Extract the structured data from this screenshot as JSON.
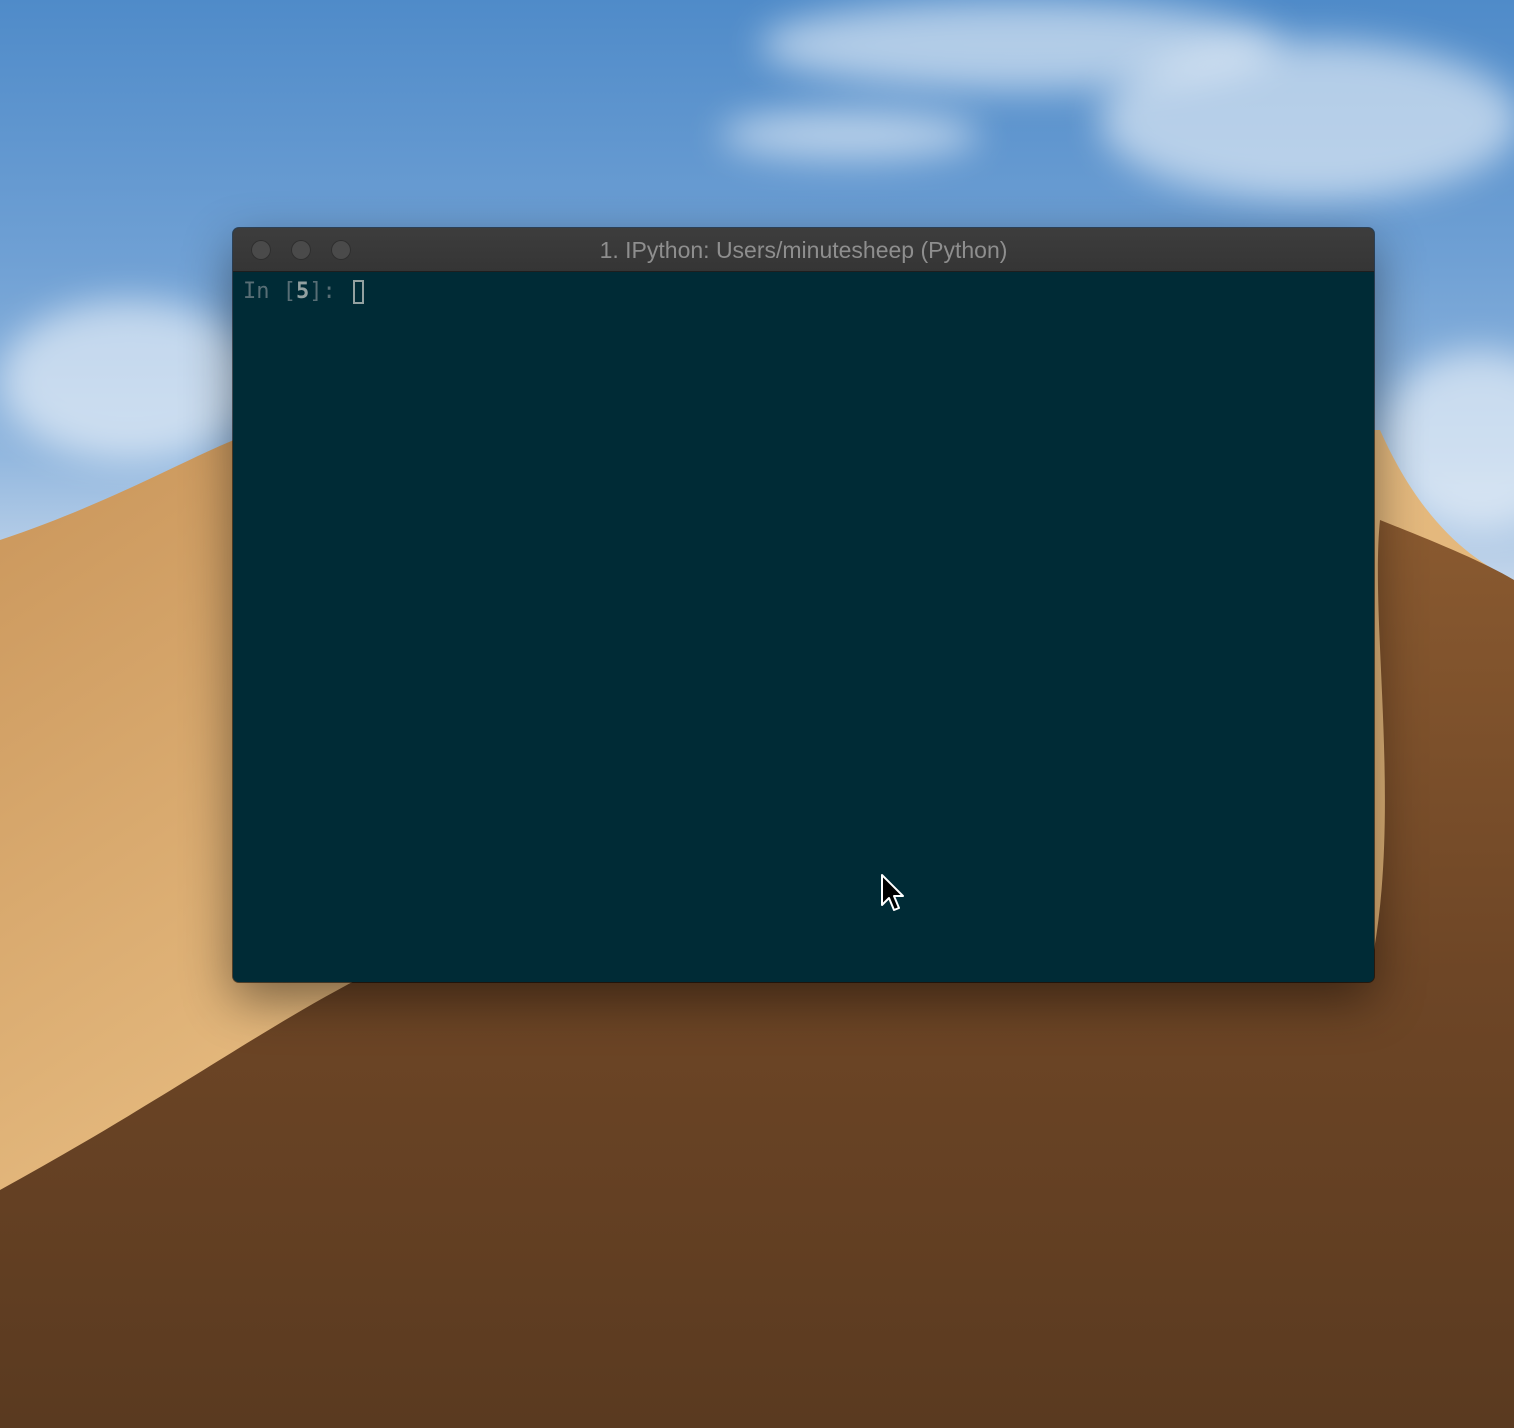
{
  "window": {
    "title": "1. IPython: Users/minutesheep (Python)"
  },
  "terminal": {
    "prompt_prefix": "In [",
    "prompt_number": "5",
    "prompt_suffix": "]: ",
    "input_value": ""
  },
  "icons": {
    "close": "close-icon",
    "minimize": "minimize-icon",
    "zoom": "zoom-icon",
    "pointer": "mouse-pointer-icon"
  },
  "colors": {
    "terminal_background": "#002b36",
    "prompt_text": "#586e75",
    "prompt_number": "#93a1a1",
    "title_text": "#8e8e8e"
  }
}
